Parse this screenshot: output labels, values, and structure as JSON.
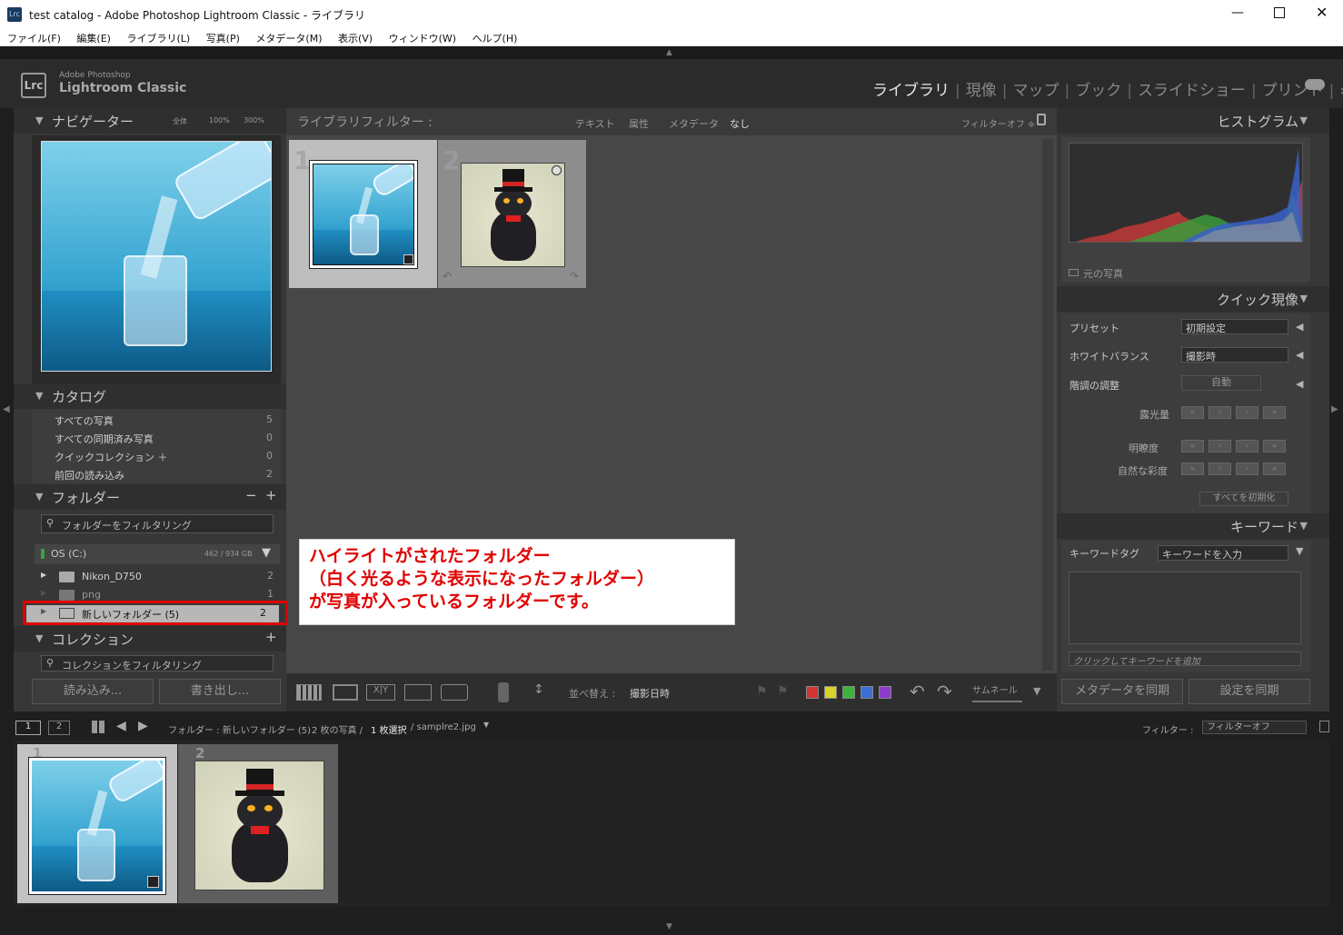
{
  "window": {
    "title": "test catalog - Adobe Photoshop Lightroom Classic - ライブラリ",
    "app_icon": "Lrc"
  },
  "menu": [
    "ファイル(F)",
    "編集(E)",
    "ライブラリ(L)",
    "写真(P)",
    "メタデータ(M)",
    "表示(V)",
    "ウィンドウ(W)",
    "ヘルプ(H)"
  ],
  "brand": {
    "line1": "Adobe Photoshop",
    "line2": "Lightroom Classic",
    "badge": "Lrc"
  },
  "modules": [
    "ライブラリ",
    "現像",
    "マップ",
    "ブック",
    "スライドショー",
    "プリント"
  ],
  "modules_more": "»",
  "navigator": {
    "title": "ナビゲーター",
    "zoom_fit": "全体",
    "zoom_100": "100%",
    "zoom_300": "300%"
  },
  "catalog": {
    "title": "カタログ",
    "items": [
      {
        "label": "すべての写真",
        "count": "5"
      },
      {
        "label": "すべての同期済み写真",
        "count": "0"
      },
      {
        "label": "クイックコレクション ＋",
        "count": "0"
      },
      {
        "label": "前回の読み込み",
        "count": "2"
      }
    ]
  },
  "folders": {
    "title": "フォルダー",
    "filter_placeholder": "フォルダーをフィルタリング",
    "volume": {
      "name": "OS (C:)",
      "size": "462 / 934 GB"
    },
    "items": [
      {
        "label": "Nikon_D750",
        "count": "2"
      },
      {
        "label": "png",
        "count": "1"
      },
      {
        "label": "新しいフォルダー (5)",
        "count": "2"
      }
    ]
  },
  "collections": {
    "title": "コレクション",
    "filter_placeholder": "コレクションをフィルタリング"
  },
  "left_buttons": {
    "import": "読み込み...",
    "export": "書き出し..."
  },
  "library_filter": {
    "title": "ライブラリフィルター :",
    "text": "テキスト",
    "attribute": "属性",
    "metadata": "メタデータ",
    "none": "なし",
    "filter_off": "フィルターオフ ≑"
  },
  "grid": {
    "cells": [
      {
        "index": "1"
      },
      {
        "index": "2"
      }
    ]
  },
  "toolbar": {
    "sort_label": "並べ替え :",
    "sort_value": "撮影日時",
    "thumb_label": "サムネール",
    "colors": [
      "#d23434",
      "#d8d22a",
      "#3cb43c",
      "#3c6ed8",
      "#8c3cc8"
    ]
  },
  "histogram": {
    "title": "ヒストグラム",
    "original": "元の写真"
  },
  "quick_develop": {
    "title": "クイック現像",
    "preset_label": "プリセット",
    "preset_value": "初期設定",
    "wb_label": "ホワイトバランス",
    "wb_value": "撮影時",
    "tone_label": "階調の調整",
    "auto": "自動",
    "exposure": "露光量",
    "clarity": "明瞭度",
    "vibrance": "自然な彩度",
    "reset": "すべてを初期化"
  },
  "keywords": {
    "title": "キーワード",
    "tag_label": "キーワードタグ",
    "tag_value": "キーワードを入力",
    "add_hint": "クリックしてキーワードを追加"
  },
  "right_buttons": {
    "sync_meta": "メタデータを同期",
    "sync_settings": "設定を同期"
  },
  "filmstrip": {
    "page1": "1",
    "page2": "2",
    "path": "フォルダー : 新しいフォルダー (5)",
    "count": "2 枚の写真 /",
    "selected": "1 枚選択",
    "file": "/ samplre2.jpg",
    "filter_label": "フィルター :",
    "filter_value": "フィルターオフ",
    "cells": [
      {
        "index": "1"
      },
      {
        "index": "2"
      }
    ]
  },
  "annotation": {
    "line1": "ハイライトがされたフォルダー",
    "line2": "（白く光るような表示になったフォルダー）",
    "line3": "が写真が入っているフォルダーです。"
  }
}
